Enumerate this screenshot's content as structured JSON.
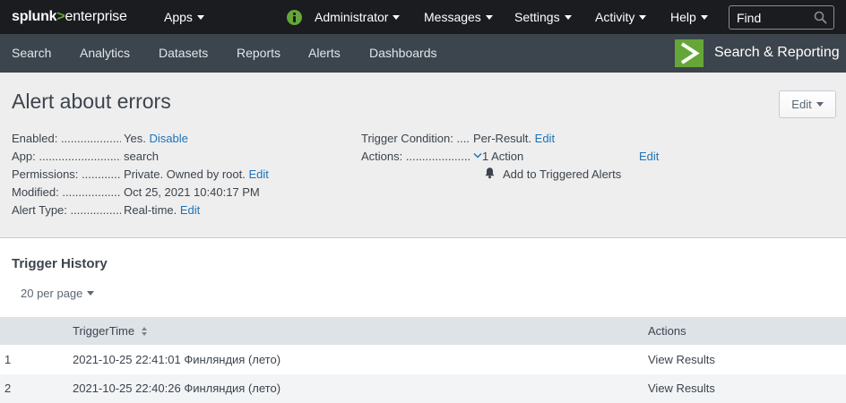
{
  "topbar": {
    "logo_part1": "splunk",
    "logo_part2": ">",
    "logo_part3": "enterprise",
    "menus": [
      {
        "label": "Apps"
      },
      {
        "label": "Administrator"
      },
      {
        "label": "Messages"
      },
      {
        "label": "Settings"
      },
      {
        "label": "Activity"
      },
      {
        "label": "Help"
      }
    ],
    "search_placeholder": "Find",
    "status_icon": "info-icon",
    "search_icon": "magnifier-icon"
  },
  "appnav": {
    "items": [
      {
        "label": "Search"
      },
      {
        "label": "Analytics"
      },
      {
        "label": "Datasets"
      },
      {
        "label": "Reports"
      },
      {
        "label": "Alerts"
      },
      {
        "label": "Dashboards"
      }
    ],
    "app_name": "Search & Reporting",
    "app_logo": "app-chevron-icon"
  },
  "header": {
    "title": "Alert about errors",
    "edit_button": "Edit",
    "left_props": [
      {
        "label": "Enabled:",
        "value": "Yes.",
        "link": "Disable"
      },
      {
        "label": "App:",
        "value": "search",
        "link": ""
      },
      {
        "label": "Permissions:",
        "value": "Private. Owned by root.",
        "link": "Edit"
      },
      {
        "label": "Modified:",
        "value": "Oct 25, 2021 10:40:17 PM",
        "link": ""
      },
      {
        "label": "Alert Type:",
        "value": "Real-time.",
        "link": "Edit"
      }
    ],
    "right_props": {
      "trigger_label": "Trigger Condition:",
      "trigger_value": "Per-Result.",
      "trigger_link": "Edit",
      "actions_label": "Actions:",
      "actions_value": "1 Action",
      "actions_link": "Edit",
      "action_item": "Add to Triggered Alerts"
    }
  },
  "history": {
    "title": "Trigger History",
    "per_page": "20 per page",
    "columns": {
      "trigger_time": "TriggerTime",
      "actions": "Actions"
    },
    "rows": [
      {
        "index": "1",
        "time": "2021-10-25 22:41:01 Финляндия (лето)",
        "action": "View Results"
      },
      {
        "index": "2",
        "time": "2021-10-25 22:40:26 Финляндия (лето)",
        "action": "View Results"
      }
    ]
  },
  "colors": {
    "topbar_bg": "#1a1c20",
    "appnav_bg": "#3c444d",
    "brand_green": "#65a637",
    "link_blue": "#1e72b8",
    "header_bg": "#eeeeee"
  }
}
